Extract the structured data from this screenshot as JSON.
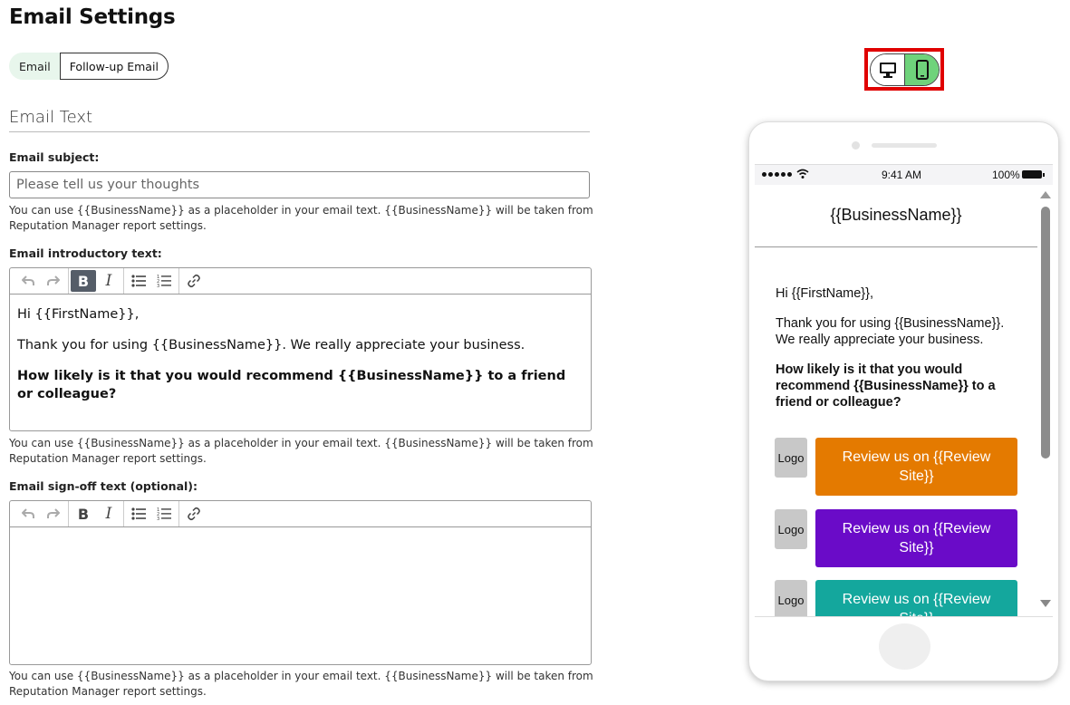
{
  "page": {
    "title": "Email Settings"
  },
  "tabs": [
    {
      "label": "Email",
      "active": true
    },
    {
      "label": "Follow-up Email",
      "active": false
    }
  ],
  "section": {
    "title": "Email Text"
  },
  "subject": {
    "label": "Email subject:",
    "placeholder": "Please tell us your thoughts",
    "value": "",
    "help": "You can use {{BusinessName}} as a placeholder in your email text. {{BusinessName}} will be taken from Reputation Manager report settings."
  },
  "intro": {
    "label": "Email introductory text:",
    "paragraphs": [
      "Hi {{FirstName}},",
      "Thank you for using {{BusinessName}}. We really appreciate your business.",
      "How likely is it that you would recommend {{BusinessName}} to a friend or colleague?"
    ],
    "help": "You can use {{BusinessName}} as a placeholder in your email text. {{BusinessName}} will be taken from Reputation Manager report settings."
  },
  "signoff": {
    "label": "Email sign-off text (optional):",
    "value": "",
    "help": "You can use {{BusinessName}} as a placeholder in your email text. {{BusinessName}} will be taken from Reputation Manager report settings."
  },
  "toolbar": {
    "icons": [
      "undo-icon",
      "redo-icon",
      "bold-icon",
      "italic-icon",
      "bulleted-list-icon",
      "numbered-list-icon",
      "link-icon"
    ],
    "bold_glyph": "B",
    "italic_glyph": "I"
  },
  "device_toggle": {
    "options": [
      "desktop-icon",
      "mobile-icon"
    ],
    "selected": "mobile",
    "selected_color": "#6fd37b",
    "highlight_color": "#e00000"
  },
  "preview": {
    "status": {
      "time": "9:41 AM",
      "battery": "100%"
    },
    "header": "{{BusinessName}}",
    "greeting": "Hi {{FirstName}},",
    "thanks": "Thank you for using {{BusinessName}}. We really appreciate your business.",
    "question": "How likely is it that you would recommend {{BusinessName}} to a friend or colleague?",
    "review_buttons": [
      {
        "logo": "Logo",
        "label": "Review us on {{Review Site}}",
        "color": "#e47a00"
      },
      {
        "logo": "Logo",
        "label": "Review us on {{Review Site}}",
        "color": "#6a0bc8"
      },
      {
        "logo": "Logo",
        "label": "Review us on {{Review Site}}",
        "color": "#14a79d"
      }
    ]
  }
}
